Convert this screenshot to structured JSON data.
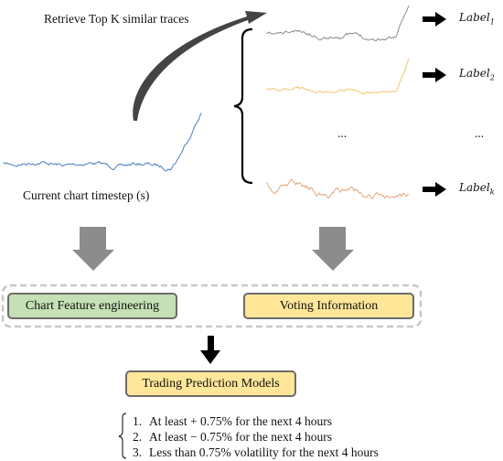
{
  "retrieve_text": "Retrieve Top K similar traces",
  "current_text": "Current chart timestep (s)",
  "labels": [
    {
      "base": "Label",
      "sub": "1"
    },
    {
      "base": "Label",
      "sub": "2"
    },
    {
      "base": "Label",
      "sub": "k"
    }
  ],
  "ellipsis": "...",
  "boxes": {
    "chart_feature": "Chart Feature engineering",
    "voting": "Voting Information",
    "trading": "Trading Prediction Models"
  },
  "outcomes": [
    {
      "num": "1.",
      "text": "At least + 0.75% for the next 4 hours"
    },
    {
      "num": "2.",
      "text": "At least − 0.75% for the next 4 hours"
    },
    {
      "num": "3.",
      "text": "Less than 0.75% volatility for the next 4 hours"
    }
  ],
  "colors": {
    "current_trace": "#4a7fc0",
    "trace_1": "#808080",
    "trace_2": "#f0c060",
    "trace_k": "#e0a070",
    "green_box": "#c5e0b4",
    "yellow_box": "#ffe699",
    "gray_arrow": "#8c8c8c"
  }
}
